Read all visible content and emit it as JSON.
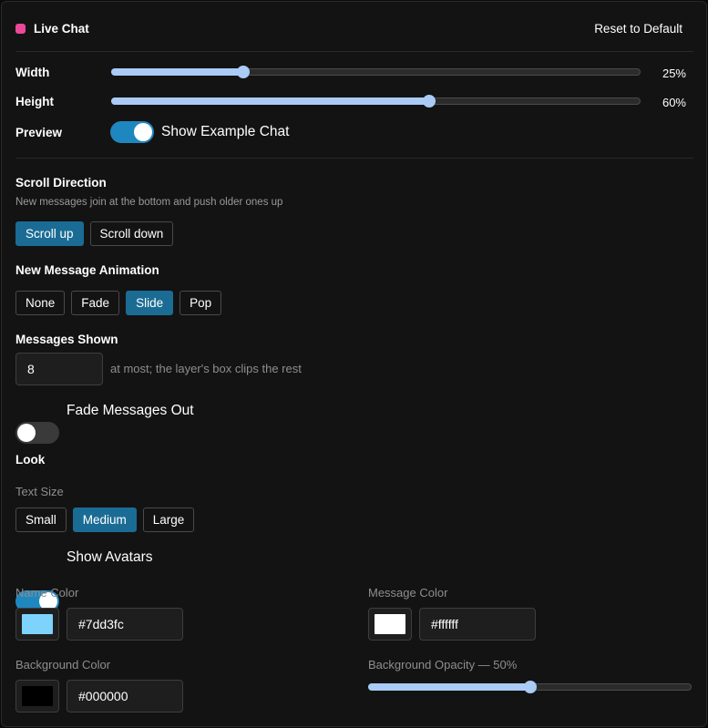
{
  "header": {
    "title": "Live Chat",
    "reset_label": "Reset to Default",
    "dot_color": "#ec4899"
  },
  "size": {
    "width_label": "Width",
    "width_value": 25,
    "width_text": "25%",
    "height_label": "Height",
    "height_value": 60,
    "height_text": "60%"
  },
  "preview": {
    "label": "Preview",
    "toggle_on": true,
    "toggle_label": "Show Example Chat"
  },
  "scroll": {
    "title": "Scroll Direction",
    "description": "New messages join at the bottom and push older ones up",
    "options": [
      "Scroll up",
      "Scroll down"
    ],
    "selected": "Scroll up"
  },
  "animation": {
    "title": "New Message Animation",
    "options": [
      "None",
      "Fade",
      "Slide",
      "Pop"
    ],
    "selected": "Slide"
  },
  "messages": {
    "title": "Messages Shown",
    "value": "8",
    "hint": "at most; the layer's box clips the rest",
    "fade_on": false,
    "fade_label": "Fade Messages Out"
  },
  "look": {
    "title": "Look",
    "text_size_label": "Text Size",
    "text_size_options": [
      "Small",
      "Medium",
      "Large"
    ],
    "text_size_selected": "Medium",
    "avatars_on": true,
    "avatars_label": "Show Avatars",
    "name_color_label": "Name Color",
    "name_color": "#7dd3fc",
    "message_color_label": "Message Color",
    "message_color": "#ffffff",
    "bg_color_label": "Background Color",
    "bg_color": "#000000",
    "bg_opacity_label": "Background Opacity — 50%",
    "bg_opacity": 50
  },
  "colors": {
    "accent": "#1b6c94",
    "toggle_on": "#1f87bf",
    "slider": "#a9cbf5"
  }
}
